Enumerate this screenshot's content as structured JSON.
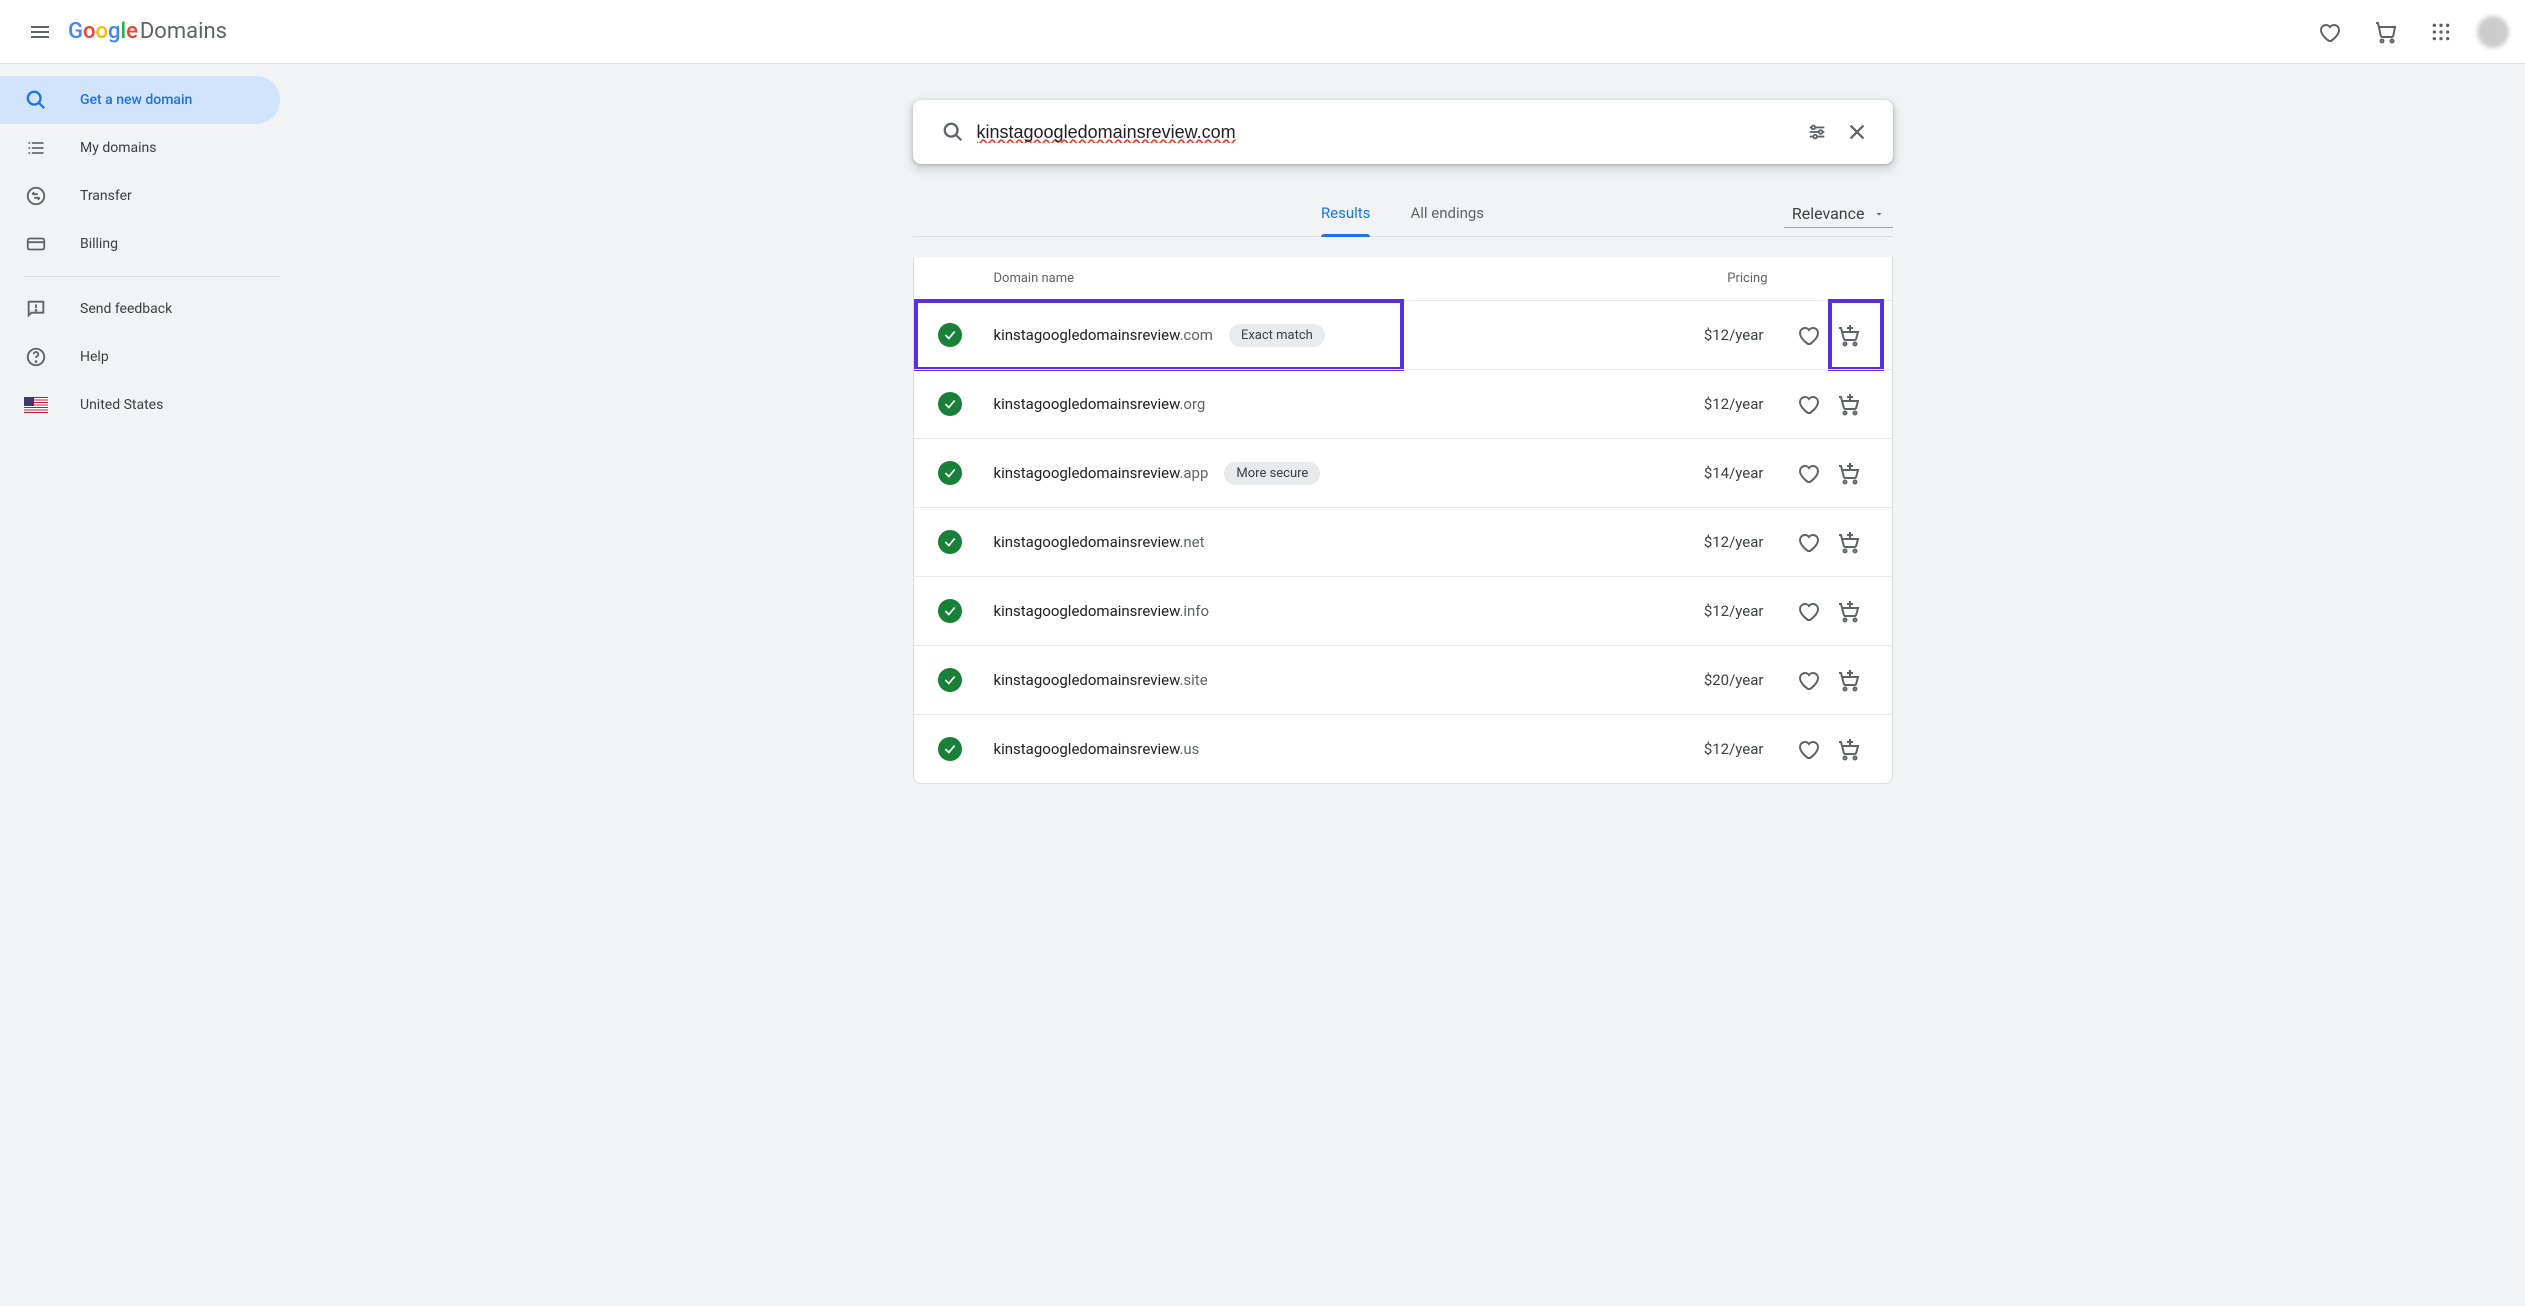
{
  "header": {
    "product": "Domains"
  },
  "sidebar": {
    "items": [
      {
        "label": "Get a new domain"
      },
      {
        "label": "My domains"
      },
      {
        "label": "Transfer"
      },
      {
        "label": "Billing"
      },
      {
        "label": "Send feedback"
      },
      {
        "label": "Help"
      },
      {
        "label": "United States"
      }
    ]
  },
  "search": {
    "query": "kinstagoogledomainsreview.com"
  },
  "tabs": {
    "results": "Results",
    "all_endings": "All endings"
  },
  "sort": {
    "label": "Relevance"
  },
  "table": {
    "name_header": "Domain name",
    "price_header": "Pricing"
  },
  "results": [
    {
      "name": "kinstagoogledomainsreview",
      "tld": ".com",
      "badge": "Exact match",
      "price": "$12/year",
      "highlight": true
    },
    {
      "name": "kinstagoogledomainsreview",
      "tld": ".org",
      "badge": null,
      "price": "$12/year"
    },
    {
      "name": "kinstagoogledomainsreview",
      "tld": ".app",
      "badge": "More secure",
      "price": "$14/year"
    },
    {
      "name": "kinstagoogledomainsreview",
      "tld": ".net",
      "badge": null,
      "price": "$12/year"
    },
    {
      "name": "kinstagoogledomainsreview",
      "tld": ".info",
      "badge": null,
      "price": "$12/year"
    },
    {
      "name": "kinstagoogledomainsreview",
      "tld": ".site",
      "badge": null,
      "price": "$20/year"
    },
    {
      "name": "kinstagoogledomainsreview",
      "tld": ".us",
      "badge": null,
      "price": "$12/year"
    }
  ]
}
